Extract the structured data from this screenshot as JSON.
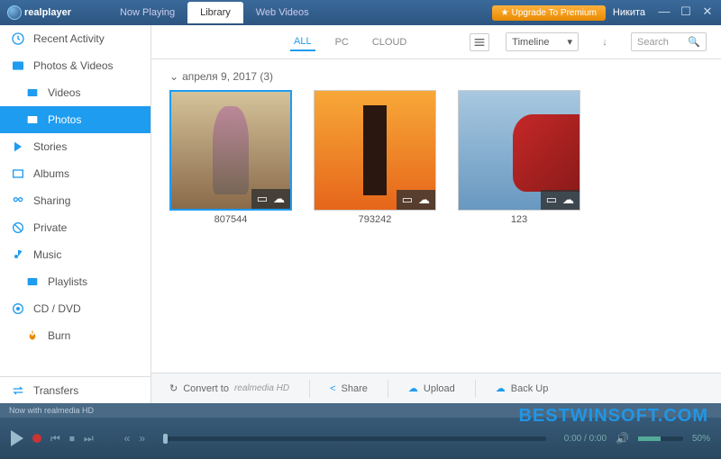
{
  "titlebar": {
    "logo_text": "realplayer",
    "tabs": {
      "now_playing": "Now Playing",
      "library": "Library",
      "web_videos": "Web Videos"
    },
    "upgrade": "Upgrade To Premium",
    "user": "Никита"
  },
  "sidebar": {
    "recent": "Recent Activity",
    "photos_videos": "Photos & Videos",
    "videos": "Videos",
    "photos": "Photos",
    "stories": "Stories",
    "albums": "Albums",
    "sharing": "Sharing",
    "private": "Private",
    "music": "Music",
    "playlists": "Playlists",
    "cd_dvd": "CD / DVD",
    "burn": "Burn",
    "transfers": "Transfers"
  },
  "content": {
    "filters": {
      "all": "ALL",
      "pc": "PC",
      "cloud": "CLOUD"
    },
    "timeline": "Timeline",
    "search_placeholder": "Search",
    "date_header": "апреля 9, 2017 (3)",
    "items": [
      {
        "label": "807544"
      },
      {
        "label": "793242"
      },
      {
        "label": "123"
      }
    ]
  },
  "bottom_toolbar": {
    "convert": "Convert to",
    "convert_brand": "realmedia HD",
    "share": "Share",
    "upload": "Upload",
    "backup": "Back Up"
  },
  "nowwith": "Now with realmedia HD",
  "player": {
    "time": "0:00 / 0:00",
    "vol": "50%"
  },
  "watermark": "BESTWINSOFT.COM"
}
